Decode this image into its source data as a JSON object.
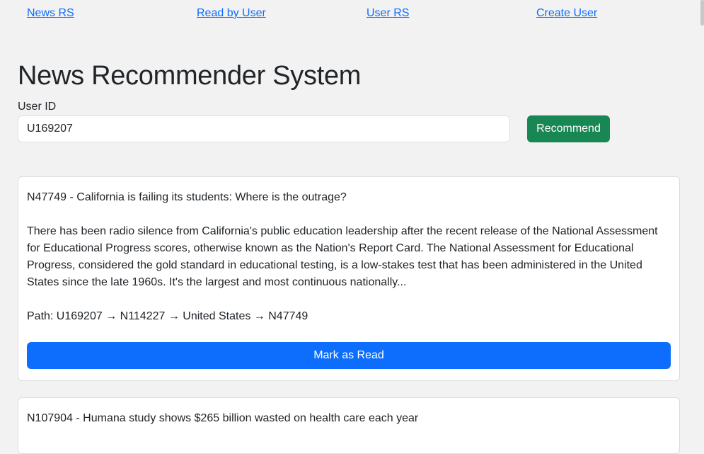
{
  "nav": [
    {
      "label": "News RS"
    },
    {
      "label": "Read by User"
    },
    {
      "label": "User RS"
    },
    {
      "label": "Create User"
    }
  ],
  "title": "News Recommender System",
  "form": {
    "label": "User ID",
    "value": "U169207",
    "button": "Recommend"
  },
  "cards": [
    {
      "title": "N47749 - California is failing its students: Where is the outrage?",
      "body": "There has been radio silence from California's public education leadership after the recent release of the National Assessment for Educational Progress scores, otherwise known as the Nation's Report Card. The National Assessment for Educational Progress, considered the gold standard in educational testing, is a low-stakes test that has been administered in the United States since the late 1960s. It's the largest and most continuous nationally...",
      "path": "Path: U169207 → N114227 → United States → N47749",
      "button": "Mark as Read"
    },
    {
      "title": "N107904 - Humana study shows $265 billion wasted on health care each year"
    }
  ]
}
